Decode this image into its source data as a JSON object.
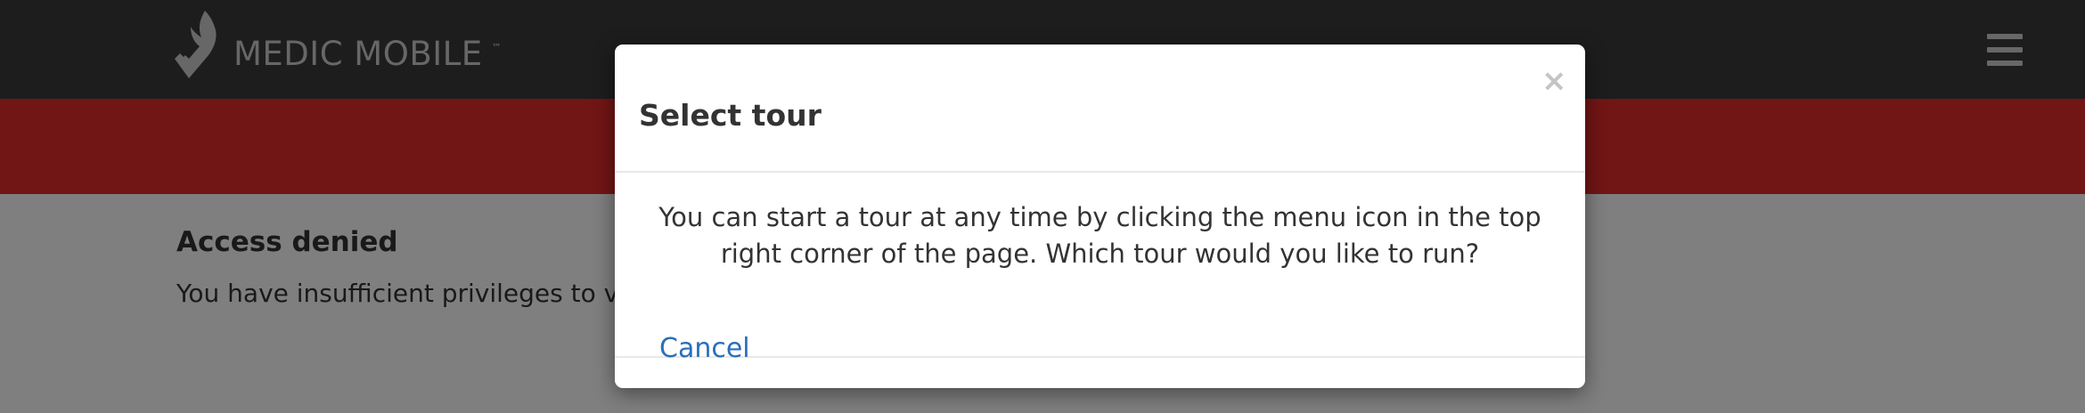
{
  "header": {
    "brand": "MEDIC MOBILE",
    "trademark": "™",
    "logo_icon": "winged-emblem-icon",
    "menu_icon": "hamburger-menu-icon"
  },
  "page": {
    "title": "Access denied",
    "text": "You have insufficient privileges to vi"
  },
  "modal": {
    "title": "Select tour",
    "close_label": "×",
    "body": "You can start a tour at any time by clicking the menu icon in the top right corner of the page. Which tour would you like to run?",
    "cancel_label": "Cancel"
  },
  "colors": {
    "navbar": "#3a3a3a",
    "alert_band": "#e52a2a",
    "link": "#2a6ebb",
    "backdrop": "rgba(0,0,0,0.5)"
  }
}
